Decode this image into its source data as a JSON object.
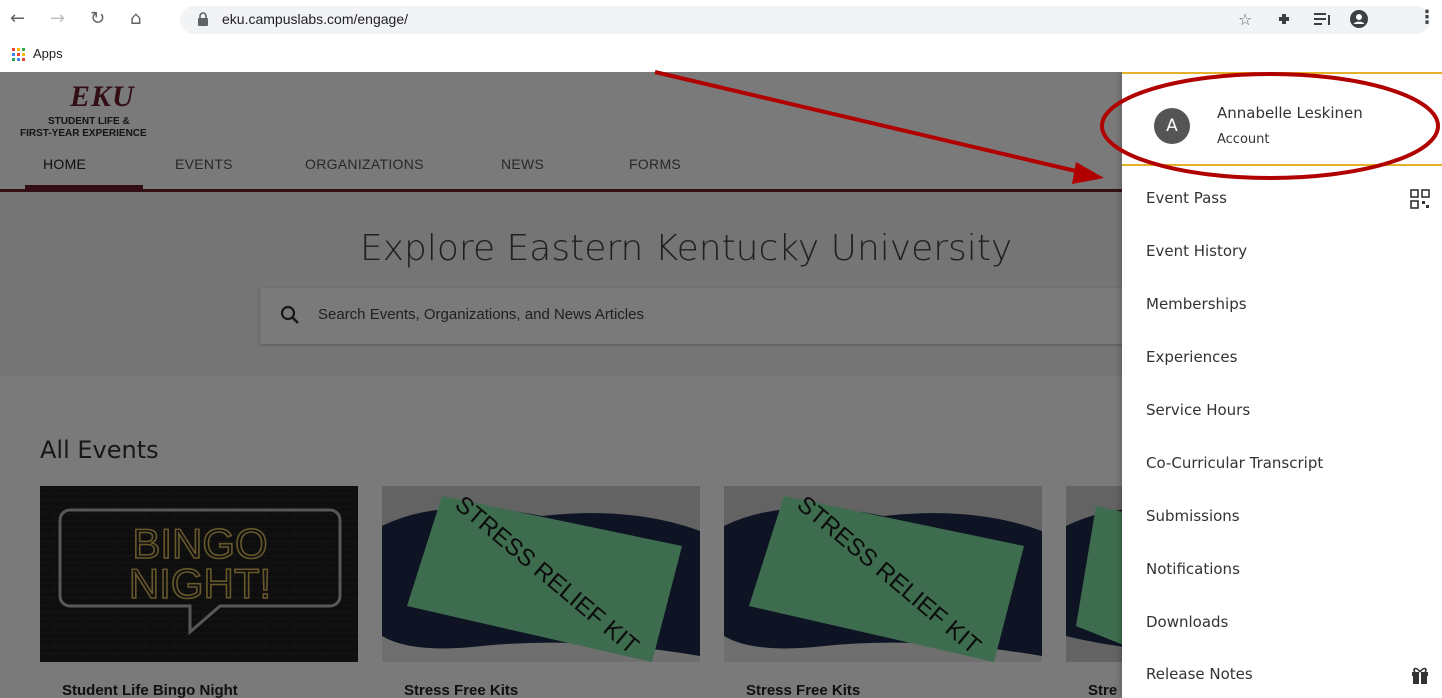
{
  "browser": {
    "url": "eku.campuslabs.com/engage/",
    "bookmark_apps": "Apps"
  },
  "site": {
    "logo_main": "EKU",
    "logo_sub1": "STUDENT LIFE &",
    "logo_sub2": "FIRST-YEAR EXPERIENCE",
    "nav": [
      "HOME",
      "EVENTS",
      "ORGANIZATIONS",
      "NEWS",
      "FORMS"
    ],
    "hero_title": "Explore Eastern Kentucky University",
    "search_placeholder": "Search Events, Organizations, and News Articles",
    "section_title": "All Events",
    "cards": [
      {
        "title": "Student Life Bingo Night",
        "image_text_1": "BINGO",
        "image_text_2": "NIGHT!"
      },
      {
        "title": "Stress Free Kits",
        "image_text": "STRESS RELIEF KIT"
      },
      {
        "title": "Stress Free Kits",
        "image_text": "STRESS RELIEF KIT"
      },
      {
        "title": "Stre"
      }
    ]
  },
  "account_menu": {
    "avatar_letter": "A",
    "name": "Annabelle Leskinen",
    "sub": "Account",
    "items": [
      {
        "label": "Event Pass",
        "icon": "qr-code-icon"
      },
      {
        "label": "Event History"
      },
      {
        "label": "Memberships"
      },
      {
        "label": "Experiences"
      },
      {
        "label": "Service Hours"
      },
      {
        "label": "Co-Curricular Transcript"
      },
      {
        "label": "Submissions"
      },
      {
        "label": "Notifications"
      },
      {
        "label": "Downloads"
      },
      {
        "label": "Release Notes",
        "icon": "gift-icon"
      }
    ]
  },
  "annotation_color": "#b00000"
}
